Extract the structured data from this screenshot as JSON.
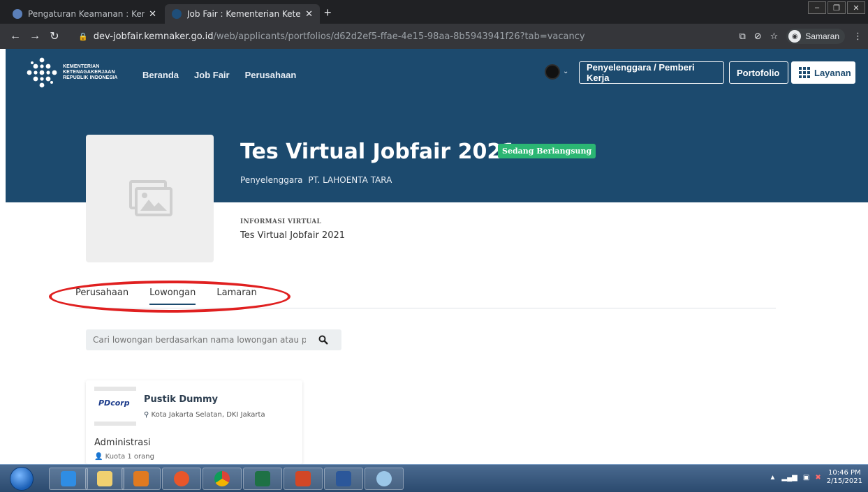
{
  "browser": {
    "tabs": [
      {
        "title": "Pengaturan Keamanan : Kemente",
        "active": false
      },
      {
        "title": "Job Fair : Kementerian Ketenagak",
        "active": true
      }
    ],
    "url_domain": "dev-jobfair.kemnaker.go.id",
    "url_path": "/web/applicants/portfolios/d62d2ef5-ffae-4e15-98aa-8b5943941f26?tab=vacancy",
    "profile_label": "Samaran"
  },
  "site": {
    "logo_lines": [
      "KEMENTERIAN",
      "KETENAGAKERJAAN",
      "REPUBLIK INDONESIA"
    ],
    "nav": [
      "Beranda",
      "Job Fair",
      "Perusahaan"
    ],
    "buttons": {
      "penyelenggara": "Penyelenggara / Pemberi Kerja",
      "portofolio": "Portofolio",
      "layanan": "Layanan"
    }
  },
  "event": {
    "title": "Tes Virtual Jobfair 2021",
    "status": "Sedang Berlangsung",
    "organizer_label": "Penyelenggara",
    "organizer_name": "PT. LAHOENTA TARA",
    "info_label": "INFORMASI VIRTUAL",
    "info_value": "Tes Virtual Jobfair 2021"
  },
  "tabs": [
    "Perusahaan",
    "Lowongan",
    "Lamaran"
  ],
  "active_tab": "Lowongan",
  "search": {
    "placeholder": "Cari lowongan berdasarkan nama lowongan atau perus"
  },
  "vacancy": {
    "company_logo_text": "PDcorp",
    "company_name": "Pustik Dummy",
    "location": "Kota Jakarta Selatan, DKI Jakarta",
    "job_title": "Administrasi",
    "quota": "Kuota 1 orang"
  },
  "taskbar": {
    "time": "10:46 PM",
    "date": "2/15/2021"
  },
  "colors": {
    "header": "#1c4a6e",
    "status": "#2bb673",
    "annotation": "#e02020"
  }
}
